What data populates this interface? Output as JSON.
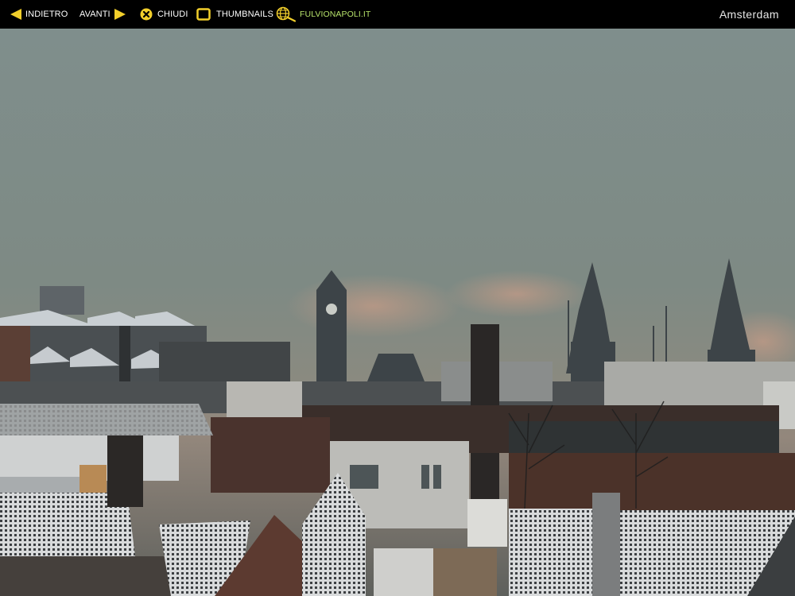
{
  "toolbar": {
    "back_label": "INDIETRO",
    "next_label": "AVANTI",
    "close_label": "CHIUDI",
    "thumbnails_label": "THUMBNAILS",
    "site_label": "FULVIONAPOLI.IT",
    "back_icon": "arrow-left-icon",
    "next_icon": "arrow-right-icon",
    "close_icon": "close-circle-icon",
    "thumbnails_icon": "thumbnails-icon",
    "site_icon": "globe-search-icon"
  },
  "photo": {
    "title": "Amsterdam"
  },
  "colors": {
    "toolbar_bg": "#000000",
    "icon_yellow": "#f2cf2b",
    "link_green": "#b6e26a",
    "label_white": "#ffffff",
    "sky": "#7a8a88"
  }
}
